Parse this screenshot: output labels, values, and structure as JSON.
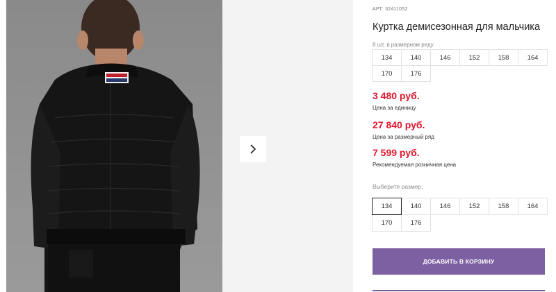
{
  "product": {
    "article": "АРТ: 32411052",
    "title": "Куртка демисезонная для мальчика",
    "pack_label": "8 шт. в размерном ряду",
    "pack_sizes": [
      "134",
      "140",
      "146",
      "152",
      "158",
      "164",
      "170",
      "176"
    ]
  },
  "prices": {
    "unit_price": "3 480 руб.",
    "unit_label": "Цена за единицу",
    "pack_price": "27 840 руб.",
    "pack_label": "Цена за размерный ряд",
    "retail_price": "7 599 руб.",
    "retail_label": "Рекомендуемая розничная цена"
  },
  "size_select": {
    "label": "Выберите размер:",
    "sizes": [
      "134",
      "140",
      "146",
      "152",
      "158",
      "164",
      "170",
      "176"
    ],
    "selected": "134"
  },
  "actions": {
    "add_to_cart": "ДОБАВИТЬ В КОРЗИНУ"
  },
  "gallery": {
    "next_icon": "chevron-right-icon"
  },
  "colors": {
    "price": "#e0162b",
    "button": "#7d60a2"
  }
}
